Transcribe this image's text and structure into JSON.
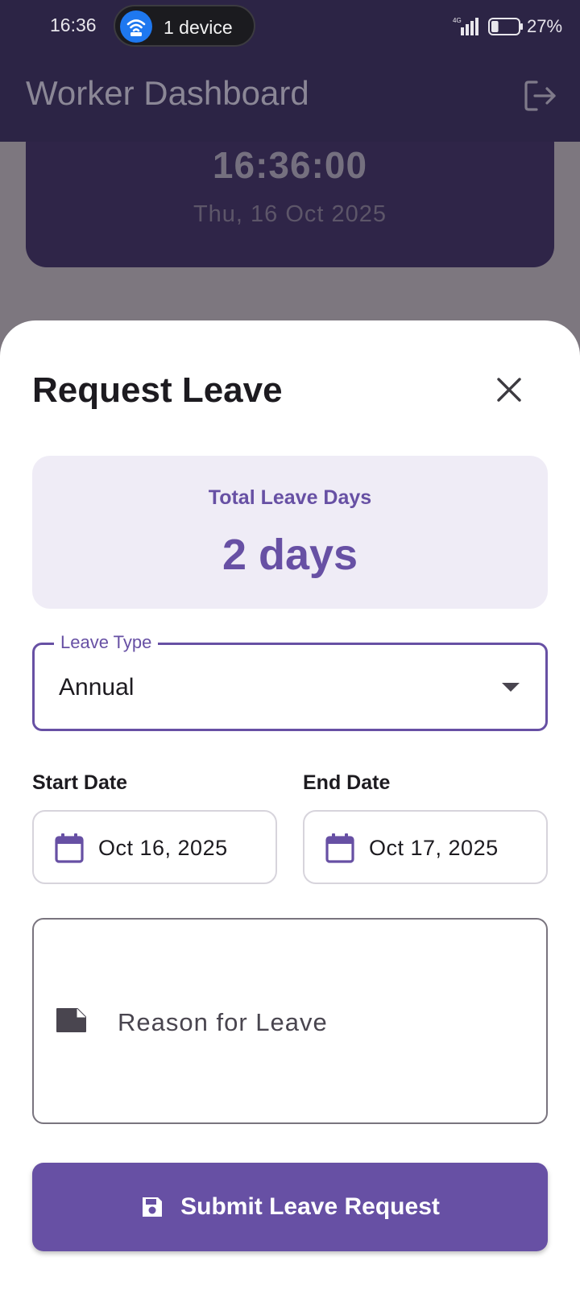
{
  "status_bar": {
    "time": "16:36",
    "hotspot_label": "1 device",
    "network_type": "4G",
    "battery_percent": "27%",
    "battery_level": 0.27
  },
  "app_bar": {
    "title": "Worker Dashboard",
    "action_icon": "logout-icon"
  },
  "clock": {
    "time": "16:36:00",
    "date": "Thu, 16 Oct 2025"
  },
  "sheet": {
    "title": "Request Leave",
    "close_icon": "close-icon",
    "total": {
      "label": "Total Leave Days",
      "value": "2 days"
    },
    "leave_type": {
      "label": "Leave Type",
      "value": "Annual"
    },
    "start_date": {
      "label": "Start Date",
      "value": "Oct 16, 2025"
    },
    "end_date": {
      "label": "End Date",
      "value": "Oct 17, 2025"
    },
    "reason": {
      "placeholder": "Reason for Leave"
    },
    "submit_label": "Submit Leave Request"
  },
  "colors": {
    "primary": "#6750a4",
    "primary_container": "#efecf6",
    "app_bar": "#2c2445"
  }
}
